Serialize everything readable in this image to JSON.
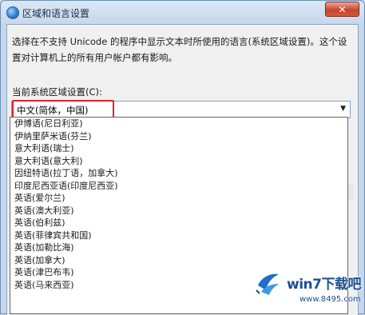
{
  "window": {
    "title": "区域和语言设置",
    "close_label": "✕"
  },
  "content": {
    "description": "选择在不支持 Unicode 的程序中显示文本时所使用的语言(系统区域设置)。这个设置对计算机上的所有用户帐户都有影响。",
    "current_label": "当前系统区域设置(C):",
    "selected_value": "中文(简体，中国)"
  },
  "dropdown": {
    "items": [
      "伊博语(尼日利亚)",
      "伊纳里萨米语(芬兰)",
      "意大利语(瑞士)",
      "意大利语(意大利)",
      "因纽特语(拉丁语，加拿大)",
      "印度尼西亚语(印度尼西亚)",
      "英语(爱尔兰)",
      "英语(澳大利亚)",
      "英语(伯利兹)",
      "英语(菲律宾共和国)",
      "英语(加勒比海)",
      "英语(加拿大)",
      "英语(津巴布韦)",
      "英语(马来西亚)"
    ]
  },
  "watermark": {
    "brand": "win7下载吧",
    "url": "www.8495.com"
  },
  "colors": {
    "highlight_border": "#e0232a",
    "title_text": "#1e2e44"
  }
}
